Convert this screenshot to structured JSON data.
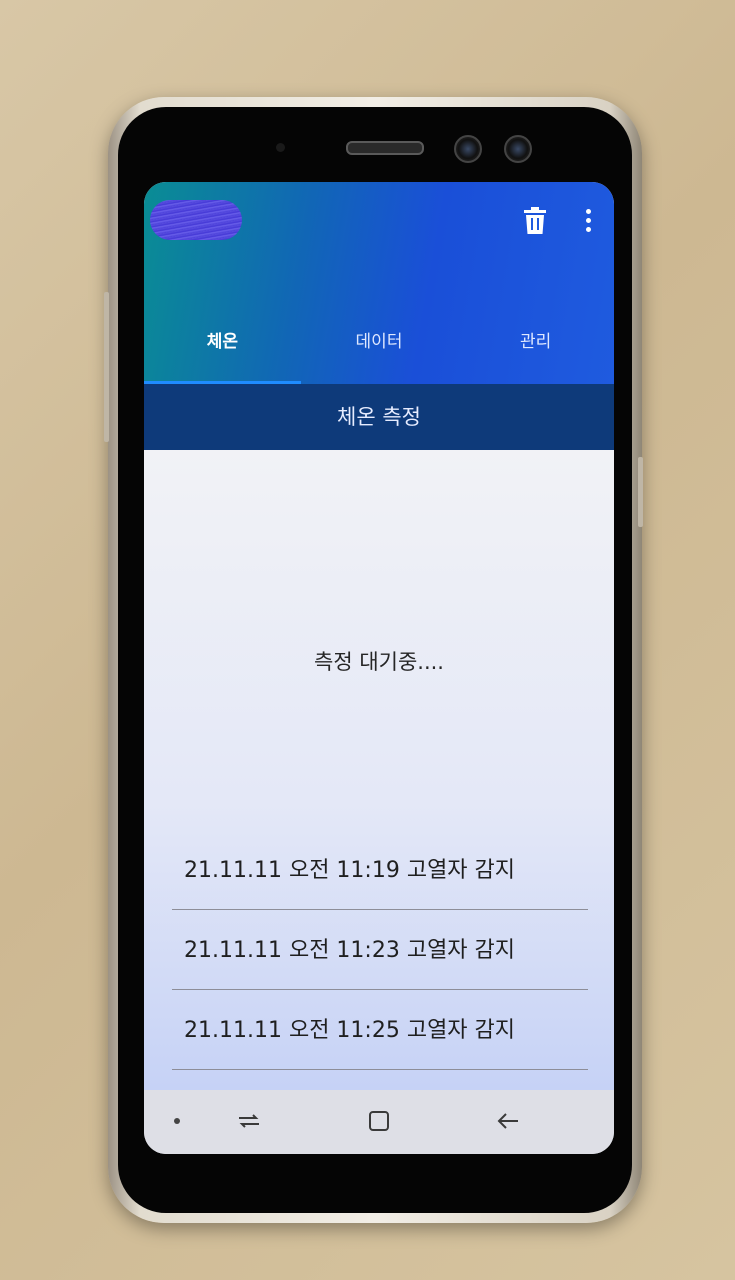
{
  "app": {
    "tabs": [
      {
        "label": "체온",
        "active": true
      },
      {
        "label": "데이터",
        "active": false
      },
      {
        "label": "관리",
        "active": false
      }
    ],
    "toolbar_icons": [
      "trash-icon",
      "more-vert-icon"
    ]
  },
  "section": {
    "title": "체온 측정"
  },
  "status": {
    "text": "측정 대기중...."
  },
  "log": [
    {
      "text": "21.11.11 오전 11:19  고열자 감지"
    },
    {
      "text": "21.11.11 오전 11:23  고열자 감지"
    },
    {
      "text": "21.11.11 오전 11:25  고열자 감지"
    }
  ],
  "navbar": {
    "icons": [
      "recent-apps-icon",
      "home-icon",
      "back-icon"
    ]
  },
  "colors": {
    "appbar_start": "#0a8d94",
    "appbar_end": "#1f5bdf",
    "section_header": "#0e3a7a",
    "tab_indicator": "#1f8cff"
  }
}
